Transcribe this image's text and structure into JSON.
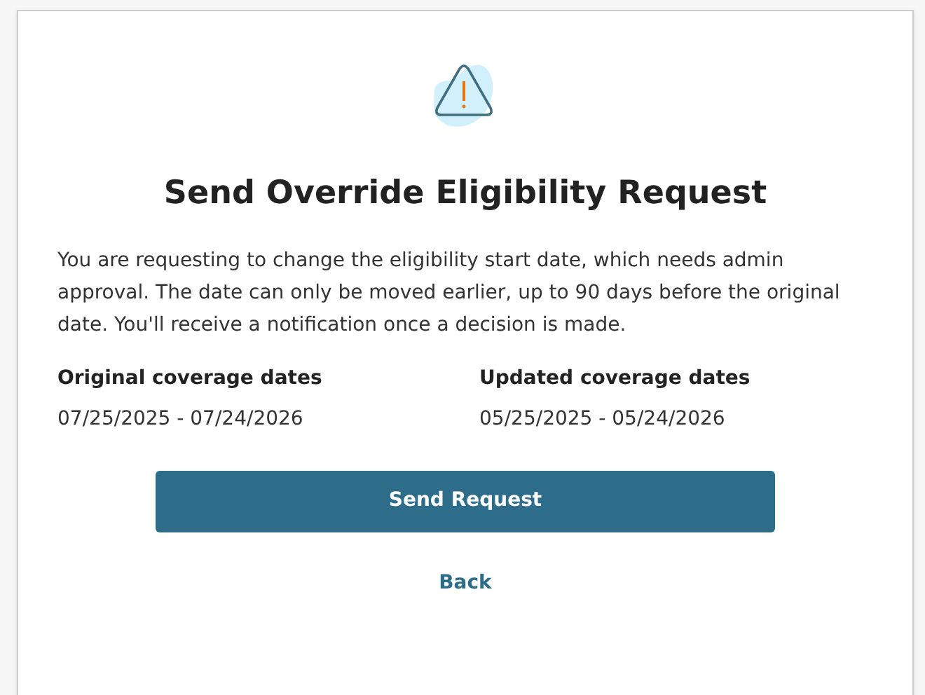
{
  "dialog": {
    "title": "Send Override Eligibility Request",
    "message": "You are requesting to change the eligibility start date, which needs admin approval. The date can only be moved earlier, up to 90 days before the original date. You'll receive a notification once a decision is made.",
    "coverage": [
      {
        "label": "Original coverage dates",
        "value": "07/25/2025 - 07/24/2026"
      },
      {
        "label": "Updated coverage dates",
        "value": "05/25/2025 - 05/24/2026"
      }
    ],
    "primary_button": "Send Request",
    "secondary_link": "Back"
  }
}
